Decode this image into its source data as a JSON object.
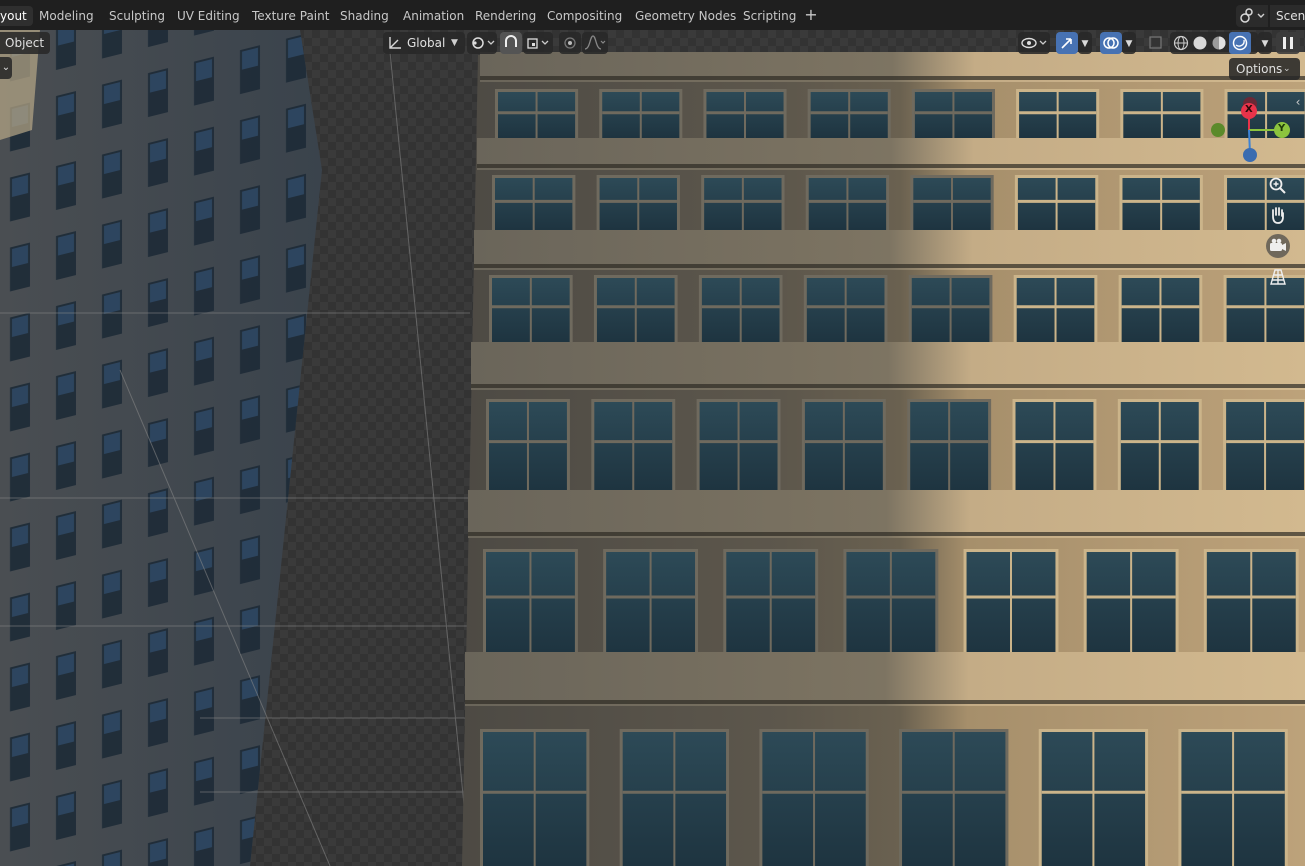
{
  "workspace_tabs": [
    {
      "label": "yout",
      "active": true
    },
    {
      "label": "Modeling",
      "active": false
    },
    {
      "label": "Sculpting",
      "active": false
    },
    {
      "label": "UV Editing",
      "active": false
    },
    {
      "label": "Texture Paint",
      "active": false
    },
    {
      "label": "Shading",
      "active": false
    },
    {
      "label": "Animation",
      "active": false
    },
    {
      "label": "Rendering",
      "active": false
    },
    {
      "label": "Compositing",
      "active": false
    },
    {
      "label": "Geometry Nodes",
      "active": false
    },
    {
      "label": "Scripting",
      "active": false
    }
  ],
  "add_workspace": "+",
  "scene_label": "Scene",
  "viewport_header": {
    "mode_label": "Object",
    "orientation": "Global",
    "options_label": "Options"
  },
  "gizmo": {
    "x_label": "X",
    "y_label": "Y"
  },
  "icons": {
    "zoom": "magnifier-plus-icon",
    "pan": "hand-icon",
    "camera": "camera-icon",
    "perspective": "grid-perspective-icon"
  },
  "colors": {
    "accent": "#4772b3",
    "axis_x": "#e8334a",
    "axis_y": "#8cc43e",
    "axis_z": "#3b82d6",
    "facade_light": "#b49a73",
    "facade_shade": "#5b554a",
    "window_glass": "#2b4855"
  }
}
